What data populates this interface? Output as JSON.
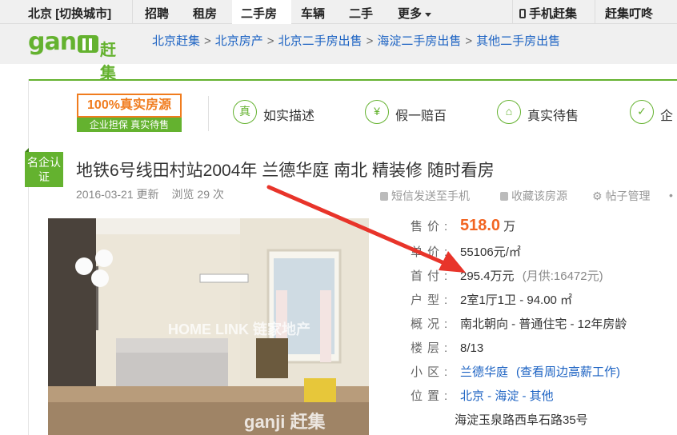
{
  "topnav": {
    "city": "北京",
    "switch_city": "[切换城市]",
    "items": [
      "招聘",
      "租房",
      "二手房",
      "车辆",
      "二手",
      "更多"
    ],
    "mobile": "手机赶集",
    "app": "赶集叮咚"
  },
  "header": {
    "logo_text": "gan",
    "logo_cn": "赶集",
    "breadcrumb": [
      "北京赶集",
      "北京房产",
      "北京二手房出售",
      "海淀二手房出售",
      "其他二手房出售"
    ]
  },
  "features": {
    "badge_main": "100%真实房源",
    "badge_sub": "企业担保  真实待售",
    "items": [
      {
        "label": "如实描述",
        "icon": "真"
      },
      {
        "label": "假一赔百",
        "icon": "¥"
      },
      {
        "label": "真实待售",
        "icon": "⌂"
      },
      {
        "label": "企",
        "icon": "✓"
      }
    ]
  },
  "listing": {
    "cert": "名企认证",
    "title": "地铁6号线田村站2004年 兰德华庭 南北 精装修 随时看房",
    "date": "2016-03-21 更新",
    "views": "浏览  29 次",
    "actions": [
      "短信发送至手机",
      "收藏该房源",
      "帖子管理"
    ],
    "watermark": "HOME LINK 链家地产",
    "watermark2": "ganji 赶集"
  },
  "details": {
    "price_label": "售价:",
    "price": "518.0",
    "price_unit": "万",
    "unit_price_label": "单价:",
    "unit_price": "55106元/㎡",
    "down_label": "首付:",
    "down": "295.4万元",
    "monthly": "(月供:16472元)",
    "layout_label": "户型:",
    "layout": "2室1厅1卫 - 94.00 ㎡",
    "overview_label": "概况:",
    "overview": "南北朝向 - 普通住宅 - 12年房龄",
    "floor_label": "楼层:",
    "floor": "8/13",
    "community_label": "小区:",
    "community": "兰德华庭",
    "community_link": "(查看周边高薪工作)",
    "location_label": "位置:",
    "location": "北京 - 海淀 - 其他",
    "address": "海淀玉泉路西阜石路35号"
  },
  "colors": {
    "green": "#64b22f",
    "orange": "#f26522",
    "link": "#1d63c3",
    "arrow": "#e8342a"
  }
}
